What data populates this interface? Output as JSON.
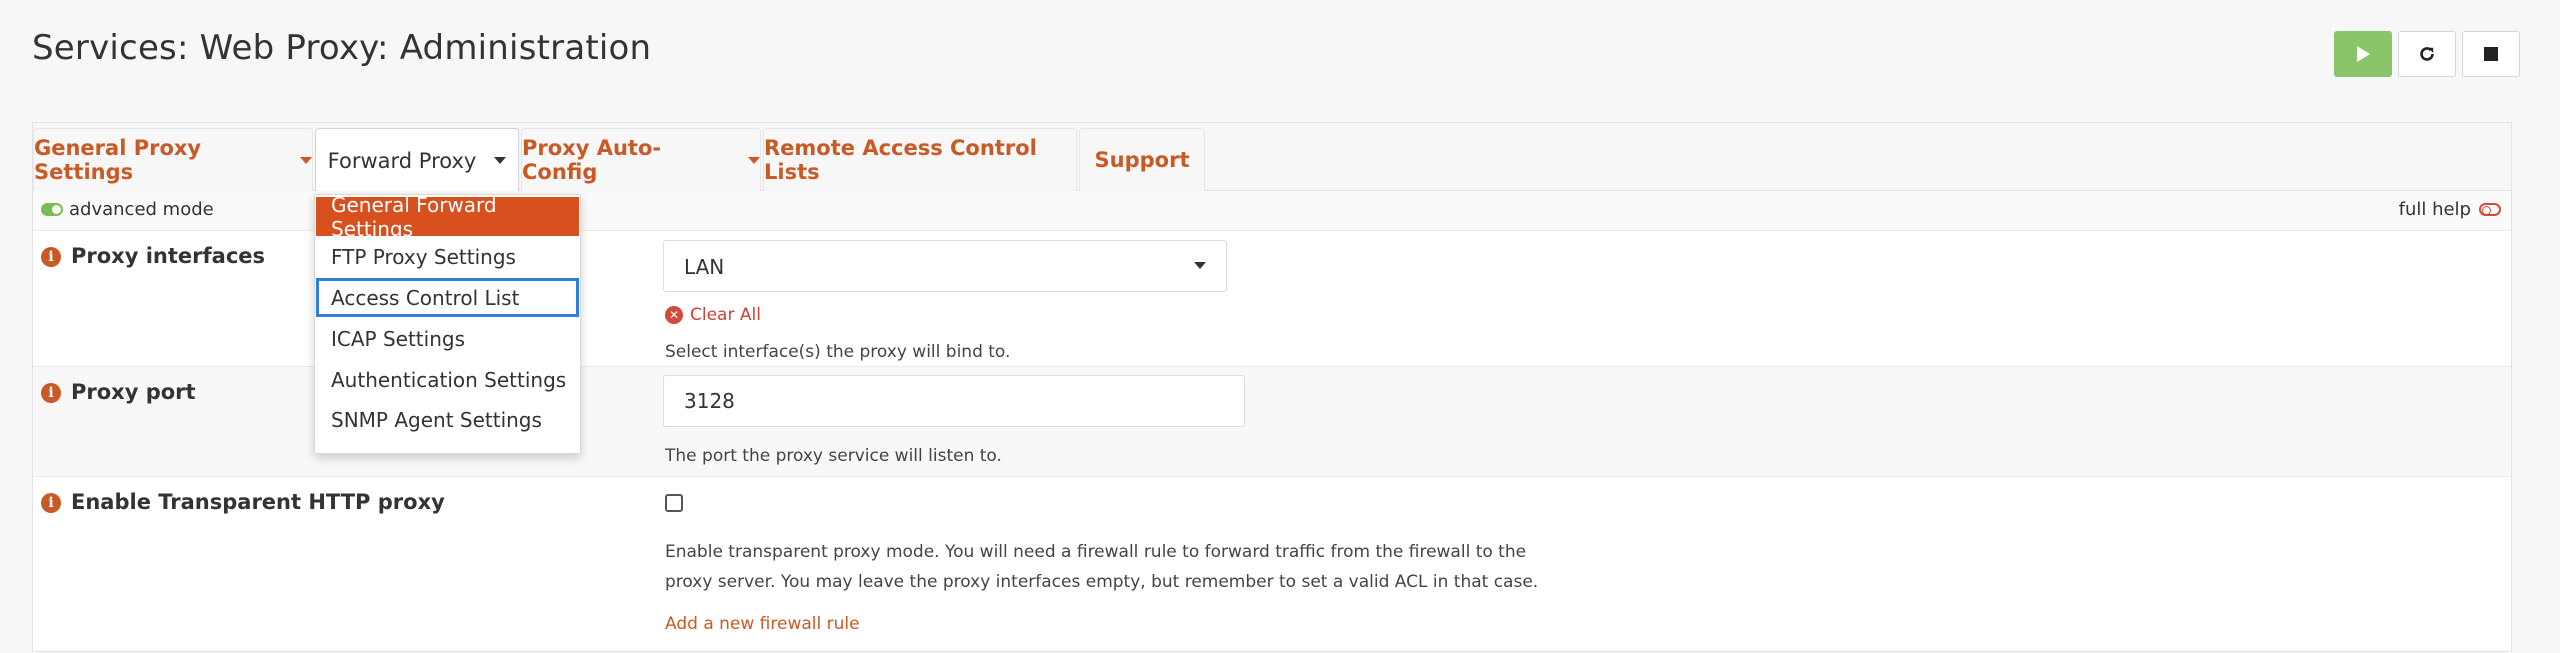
{
  "page_title": "Services: Web Proxy: Administration",
  "service_controls": [
    {
      "name": "start",
      "icon": "play-icon"
    },
    {
      "name": "restart",
      "icon": "refresh-icon"
    },
    {
      "name": "stop",
      "icon": "stop-icon"
    }
  ],
  "tabs": [
    {
      "label": "General Proxy Settings",
      "dropdown": true,
      "active": false
    },
    {
      "label": "Forward Proxy",
      "dropdown": true,
      "active": true
    },
    {
      "label": "Proxy Auto-Config",
      "dropdown": true,
      "active": false
    },
    {
      "label": "Remote Access Control Lists",
      "dropdown": false,
      "active": false
    },
    {
      "label": "Support",
      "dropdown": false,
      "active": false
    }
  ],
  "forward_proxy_menu": [
    {
      "label": "General Forward Settings",
      "state": "active"
    },
    {
      "label": "FTP Proxy Settings",
      "state": ""
    },
    {
      "label": "Access Control List",
      "state": "focused"
    },
    {
      "label": "ICAP Settings",
      "state": ""
    },
    {
      "label": "Authentication Settings",
      "state": ""
    },
    {
      "label": "SNMP Agent Settings",
      "state": ""
    }
  ],
  "modebar": {
    "advanced_mode_label": "advanced mode",
    "advanced_mode_on": true,
    "full_help_label": "full help",
    "full_help_on": false
  },
  "fields": {
    "proxy_interfaces": {
      "label": "Proxy interfaces",
      "value": "LAN",
      "clear_all": "Clear All",
      "help": "Select interface(s) the proxy will bind to."
    },
    "proxy_port": {
      "label": "Proxy port",
      "value": "3128",
      "help": "The port the proxy service will listen to."
    },
    "transparent_http": {
      "label": "Enable Transparent HTTP proxy",
      "checked": false,
      "help_line1": "Enable transparent proxy mode. You will need a firewall rule to forward traffic from the firewall to the",
      "help_line2": "proxy server. You may leave the proxy interfaces empty, but remember to set a valid ACL in that case.",
      "link": "Add a new firewall rule"
    }
  },
  "colors": {
    "accent": "#c95a26",
    "menu_active": "#d9501f",
    "start_button": "#8bc56a",
    "focus_ring": "#2f7fd8",
    "danger": "#d24a3a"
  }
}
